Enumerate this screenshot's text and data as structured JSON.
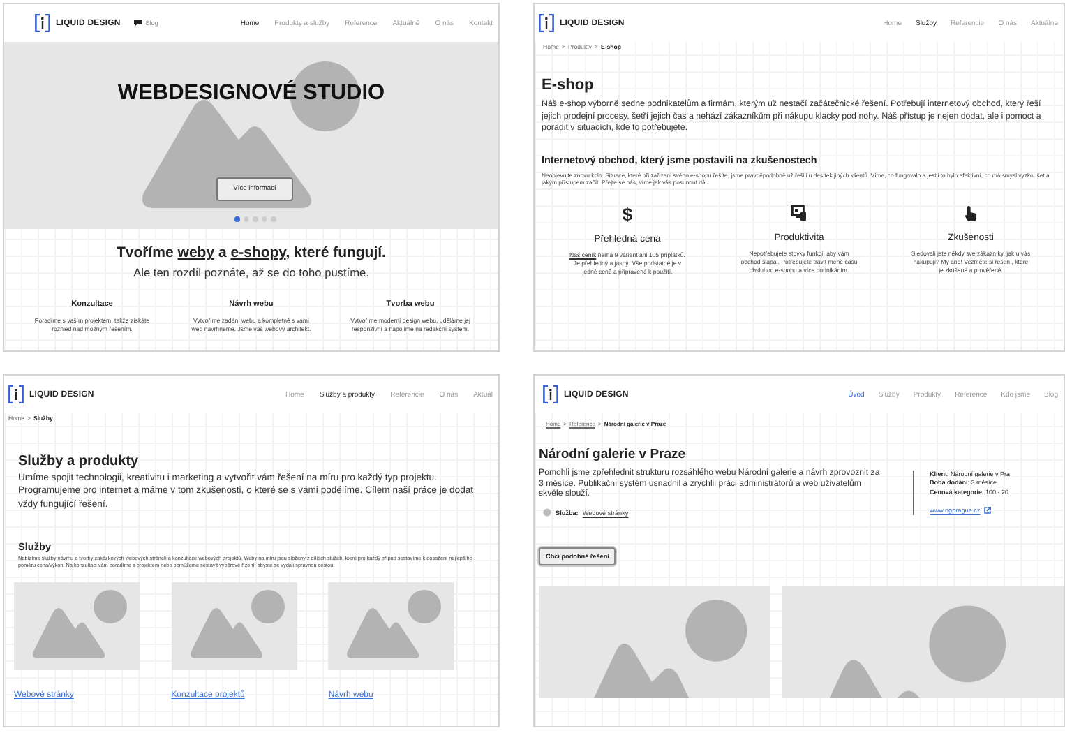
{
  "pages": [
    {
      "kind": "home",
      "header": {
        "logo": "LIQUID DESIGN",
        "blog": "Blog",
        "kind": "dark",
        "nav": [
          {
            "label": "Home",
            "selected": true
          },
          {
            "label": "Produkty a služby",
            "selected": false
          },
          {
            "label": "Reference",
            "selected": false
          },
          {
            "label": "Aktuálně",
            "selected": false
          },
          {
            "label": "O nás",
            "selected": false
          },
          {
            "label": "Kontakt",
            "selected": false
          }
        ]
      },
      "hero": {
        "title": "WEBDESIGNOVÉ STUDIO",
        "button": "Více informací",
        "dots": [
          {
            "selected": true
          },
          {
            "selected": false
          },
          {
            "selected": false
          },
          {
            "selected": false
          },
          {
            "selected": false
          }
        ]
      },
      "headline": [
        {
          "text": "Tvoříme "
        },
        {
          "text": "weby",
          "kind": "link"
        },
        {
          "text": " a "
        },
        {
          "text": "e-shopy",
          "kind": "link"
        },
        {
          "text": ", které fungují."
        }
      ],
      "subline": "Ale ten rozdíl poznáte, až se do toho pustíme.",
      "columns": [
        {
          "title": "Konzultace",
          "text": "Poradíme s vaším projektem, takže získáte rozhled nad možným řešením."
        },
        {
          "title": "Návrh webu",
          "text": "Vytvoříme zadání webu a kompletně s vámi web navrhneme. Jsme váš webový architekt."
        },
        {
          "title": "Tvorba webu",
          "text": "Vytvoříme moderní design webu, uděláme jej responzivní a napojíme na redakční systém."
        }
      ]
    },
    {
      "kind": "product",
      "header": {
        "logo": "LIQUID DESIGN",
        "kind": "dark",
        "nav": [
          {
            "label": "Home",
            "selected": false
          },
          {
            "label": "Služby",
            "selected": true
          },
          {
            "label": "Referencie",
            "selected": false
          },
          {
            "label": "O nás",
            "selected": false
          },
          {
            "label": "Aktuálne",
            "selected": false
          }
        ]
      },
      "breadcrumb": {
        "separator": ">",
        "items": [
          {
            "text": "Home",
            "current": false
          },
          {
            "text": "Produkty",
            "current": false
          },
          {
            "text": "E-shop",
            "current": true
          }
        ]
      },
      "heading": "E-shop",
      "paragraph": "Náš e-shop výborně sedne podnikatelům a firmám, kterým už nestačí začátečnické řešení. Potřebují internetový obchod, který řeší jejich prodejní procesy, šetří jejich čas a nehází zákazníkům při nákupu klacky pod nohy. Náš přístup je nejen dodat, ale i pomoct a poradit v situacích, kde to potřebujete.",
      "subheading": "Internetový obchod, který jsme postavili na zkušenostech",
      "small_text": "Neobjevujte znovu kolo. Situace, které při zařízení svého e-shopu řešíte, jsme pravděpodobně už řešili u desítek jiných klientů. Víme, co fungovalo a jestli to bylo efektivní, co má smysl vyzkoušet a jakým přístupem začít. Přejte se nás, víme jak vás posunout dál.",
      "features": [
        {
          "symbol": "$",
          "title": "Přehledná cena",
          "text": [
            {
              "text": "Náš ceník",
              "kind": "link"
            },
            {
              "text": " nemá 9 variant ani 105 příplatků. Je přehledný a jasný. Vše podstatné je v jedné ceně a připravené k použití."
            }
          ]
        },
        {
          "title": "Produktivita",
          "text": [
            {
              "text": "Nepotřebujete stovky funkcí, aby vám obchod šlapal. Potřebujete trávit méně času obsluhou e-shopu a více podnikáním."
            }
          ]
        },
        {
          "title": "Zkušenosti",
          "text": [
            {
              "text": "Sledovali jste někdy své zákazníky, jak u vás nakupují? My ano! Vezměte si řešení, které je zkušené a prověřené."
            }
          ]
        }
      ]
    },
    {
      "kind": "services",
      "header": {
        "logo": "LIQUID DESIGN",
        "kind": "dark",
        "nav": [
          {
            "label": "Home",
            "selected": false
          },
          {
            "label": "Služby a produkty",
            "selected": true
          },
          {
            "label": "Referencie",
            "selected": false
          },
          {
            "label": "O nás",
            "selected": false
          },
          {
            "label": "Aktuál",
            "selected": false
          }
        ]
      },
      "breadcrumb": {
        "separator": ">",
        "items": [
          {
            "text": "Home",
            "current": false
          },
          {
            "text": "Služby",
            "current": true
          }
        ]
      },
      "heading": "Služby a produkty",
      "paragraph": "Umíme spojit technologii, kreativitu i marketing a vytvořit vám řešení na míru pro každý typ projektu. Programujeme pro internet a máme v tom zkušenosti, o které se s vámi podělíme. Cílem naší práce je dodat vždy fungující řešení.",
      "subheading": "Služby",
      "small_text": "Nabízíme služby návrhu a tvorby zakázkových webových stránek a konzultace webových projektů. Weby na míru jsou složeny z dílčích služeb, které pro každý případ sestavíme k dosažení nejlepšího poměru cena/výkon. Na konzultaci vám poradíme s projektem nebo pomůžeme sestavit výběrové řízení, abyste se vydali správnou cestou.",
      "cards": [
        {
          "kind": "picture",
          "link": "Webové stránky"
        },
        {
          "kind": "picture",
          "link": "Konzultace projektů"
        },
        {
          "kind": "picture",
          "link": "Návrh webu"
        }
      ]
    },
    {
      "kind": "reference",
      "header": {
        "logo": "LIQUID DESIGN",
        "kind": "accent",
        "nav": [
          {
            "label": "Úvod",
            "selected": true
          },
          {
            "label": "Služby",
            "selected": false
          },
          {
            "label": "Produkty",
            "selected": false
          },
          {
            "label": "Reference",
            "selected": false
          },
          {
            "label": "Kdo jsme",
            "selected": false
          },
          {
            "label": "Blog",
            "selected": false
          }
        ]
      },
      "breadcrumb": {
        "separator": ">",
        "items": [
          {
            "text": "Home",
            "current": false,
            "link": true
          },
          {
            "text": "Reference",
            "current": false,
            "link": true
          },
          {
            "text": "Národní galerie v Praze",
            "current": true
          }
        ]
      },
      "heading": "Národní galerie v Praze",
      "paragraph": "Pomohli jsme zpřehlednit strukturu rozsáhlého webu Národní galerie a návrh zprovoznit za 3 měsíce. Publikační systém usnadnil a zrychlil práci administrátorů a web uživatelům skvěle slouží.",
      "service": {
        "label": "Služba:",
        "link": "Webové stránky"
      },
      "facts": [
        "**Klient**: Národní galerie v Pra",
        "**Doba dodání**: 3 měsíce",
        "**Cenová kategorie**: 100 - 20"
      ],
      "website": "www.ngprague.cz",
      "button": "Chci podobné řešení",
      "pictures": [
        {
          "kind": "picture"
        },
        {
          "kind": "picture"
        }
      ]
    }
  ]
}
